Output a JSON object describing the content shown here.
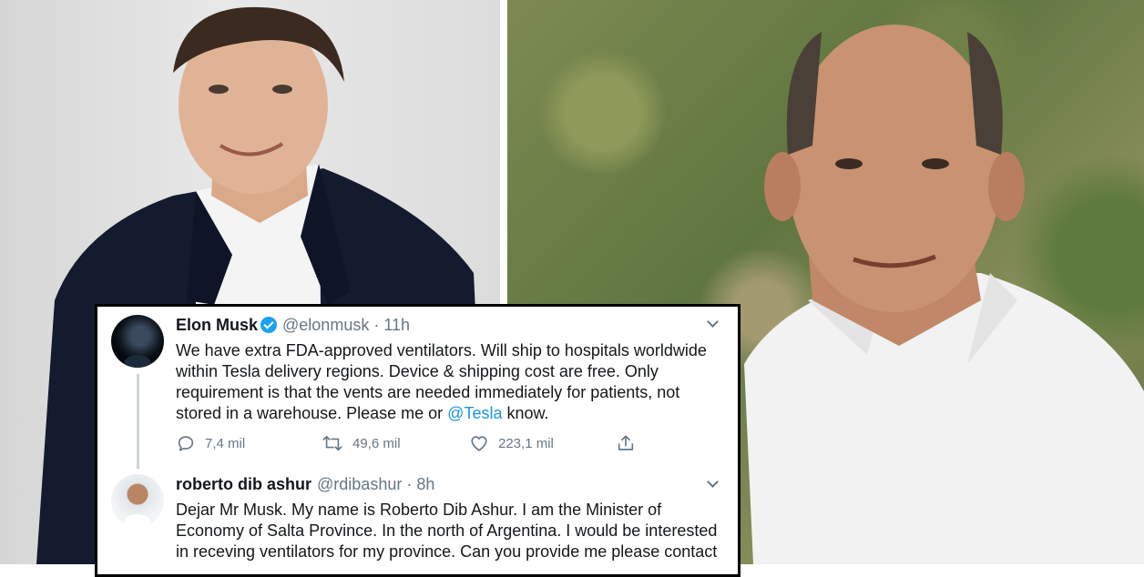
{
  "tweets": [
    {
      "name": "Elon Musk",
      "verified": true,
      "handle": "@elonmusk",
      "separator": "·",
      "time": "11h",
      "text_before": "We have extra FDA-approved ventilators. Will ship to hospitals worldwide within Tesla delivery regions. Device & shipping cost are free. Only requirement is that the vents are needed immediately for patients, not stored in a warehouse. Please me or ",
      "mention": "@Tesla",
      "text_after": " know.",
      "replies": "7,4 mil",
      "retweets": "49,6 mil",
      "likes": "223,1 mil"
    },
    {
      "name": "roberto dib ashur",
      "handle": "@rdibashur",
      "separator": "·",
      "time": "8h",
      "text": "Dejar Mr Musk. My name is Roberto Dib Ashur. I am the Minister of Economy of Salta Province. In the north of Argentina. I would be interested in receving ventilators for my province. Can you provide me please contact"
    }
  ],
  "icons": {
    "reply": "reply-icon",
    "retweet": "retweet-icon",
    "like": "heart-icon",
    "share": "share-icon",
    "verified": "verified-badge-icon",
    "more": "chevron-down-icon"
  },
  "colors": {
    "link": "#1b95e0",
    "verified": "#1da1f2",
    "secondary_text": "#657786"
  }
}
